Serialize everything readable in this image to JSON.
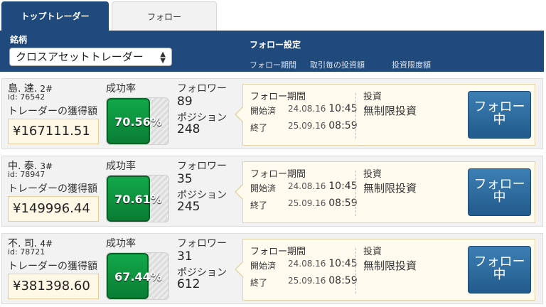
{
  "tabs": [
    {
      "label": "トップトレーダー",
      "active": true
    },
    {
      "label": "フォロー",
      "active": false
    }
  ],
  "filter": {
    "symbol_label": "銘柄",
    "symbol_value": "クロスアセットトレーダー",
    "settings_label": "フォロー設定",
    "columns": [
      "フォロー期間",
      "取引毎の投資額",
      "投資限度額"
    ]
  },
  "labels": {
    "success_rate": "成功率",
    "followers": "フォロワー",
    "positions": "ポジション",
    "gain": "トレーダーの獲得額",
    "follow_period": "フォロー期間",
    "start": "開始済",
    "end": "終了",
    "investment": "投資",
    "follow_button": "フォロー中"
  },
  "traders": [
    {
      "name": "島. 達.",
      "rank": "2#",
      "id": "id: 76542",
      "gain": "¥167111.51",
      "success_rate": "70.56%",
      "success_value": 70.56,
      "followers": "89",
      "positions": "248",
      "start_date": "24.08.16",
      "start_time": "10:45",
      "end_date": "25.09.16",
      "end_time": "08:59",
      "investment": "無制限投資"
    },
    {
      "name": "中. 泰.",
      "rank": "3#",
      "id": "id: 78947",
      "gain": "¥149996.44",
      "success_rate": "70.61%",
      "success_value": 70.61,
      "followers": "35",
      "positions": "245",
      "start_date": "24.08.16",
      "start_time": "10:45",
      "end_date": "25.09.16",
      "end_time": "08:59",
      "investment": "無制限投資"
    },
    {
      "name": "不. 司.",
      "rank": "4#",
      "id": "id: 78721",
      "gain": "¥381398.60",
      "success_rate": "67.44%",
      "success_value": 67.44,
      "followers": "31",
      "positions": "612",
      "start_date": "24.08.16",
      "start_time": "10:45",
      "end_date": "25.09.16",
      "end_time": "08:59",
      "investment": "無制限投資"
    }
  ],
  "colors": {
    "header_bg": "#204a7c",
    "bar_green": "#0a7d34",
    "button_blue": "#2f6fa3"
  }
}
